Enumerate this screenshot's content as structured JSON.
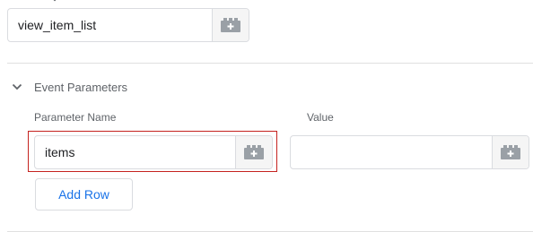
{
  "event_name": {
    "value": "view_item_list",
    "variable_icon": "variable-brick-icon"
  },
  "event_parameters": {
    "title": "Event Parameters",
    "toggle_icon": "chevron-down-icon",
    "columns": {
      "name_label": "Parameter Name",
      "value_label": "Value"
    },
    "rows": [
      {
        "name": "items",
        "value": ""
      }
    ],
    "add_row_label": "Add Row"
  },
  "colors": {
    "accent": "#1a73e8",
    "highlight": "#c5221f",
    "border": "#dadce0",
    "icon": "#9aa0a6"
  }
}
